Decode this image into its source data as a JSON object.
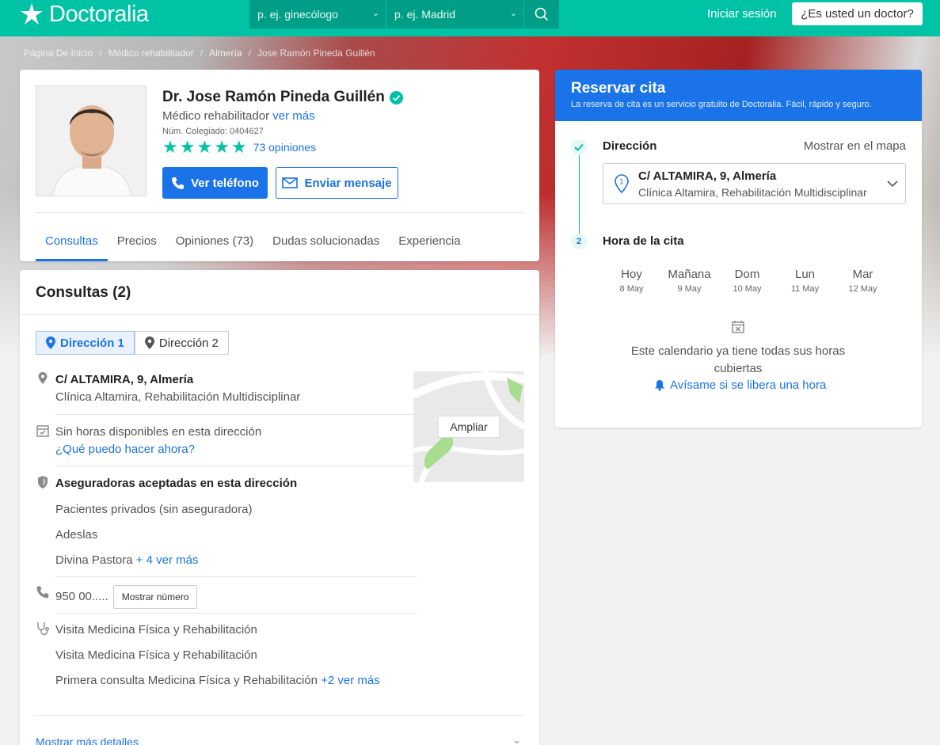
{
  "header": {
    "logo_text": "Doctoralia",
    "search_specialty_placeholder": "p. ej. ginecólogo",
    "search_location_placeholder": "p. ej. Madrid",
    "login_label": "Iniciar sesión",
    "doctor_button_label": "¿Es usted un doctor?",
    "brand_color": "#00c3a5"
  },
  "breadcrumb": [
    "Página De Inicio",
    "Médico rehabilitador",
    "Almería",
    "Jose Ramón Pineda Guillén"
  ],
  "profile": {
    "name": "Dr. Jose Ramón Pineda Guillén",
    "specialty": "Médico rehabilitador",
    "see_more": "ver más",
    "license": "Núm. Colegiado: 0404627",
    "rating_stars": 5,
    "reviews_link": "73 opiniones",
    "phone_button": "Ver teléfono",
    "message_button": "Enviar mensaje",
    "tabs": [
      "Consultas",
      "Precios",
      "Opiniones (73)",
      "Dudas solucionadas",
      "Experiencia"
    ]
  },
  "consultas": {
    "title": "Consultas (2)",
    "address_tabs": [
      "Dirección 1",
      "Dirección 2"
    ],
    "address": "C/ ALTAMIRA, 9, Almería",
    "clinic": "Clínica Altamira, Rehabilitación Multidisciplinar",
    "map_button": "Ampliar",
    "no_slots": "Sin horas disponibles en esta dirección",
    "what_now": "¿Qué puedo hacer ahora?",
    "insurers_title": "Aseguradoras aceptadas en esta dirección",
    "insurers": [
      "Pacientes privados (sin aseguradora)",
      "Adeslas",
      "Divina Pastora"
    ],
    "insurers_more": "+ 4 ver más",
    "phone": "950 00.....",
    "show_number": "Mostrar número",
    "services": [
      "Visita Medicina Física y Rehabilitación",
      "Visita Medicina Física y Rehabilitación",
      "Primera consulta Medicina Física y Rehabilitación"
    ],
    "services_more": "+2 ver más",
    "more_details": "Mostrar más detalles"
  },
  "booking": {
    "title": "Reservar cita",
    "subtitle": "La reserva de cita es un servicio gratuito de Doctoralia. Fácil, rápido y seguro.",
    "step1_label": "Dirección",
    "show_on_map": "Mostrar en el mapa",
    "address_number": "1",
    "address": "C/ ALTAMIRA, 9, Almería",
    "clinic": "Clínica Altamira, Rehabilitación Multidisciplinar",
    "step2_number": "2",
    "step2_label": "Hora de la cita",
    "days": [
      {
        "day": "Hoy",
        "date": "8 May"
      },
      {
        "day": "Mañana",
        "date": "9 May"
      },
      {
        "day": "Dom",
        "date": "10 May"
      },
      {
        "day": "Lun",
        "date": "11 May"
      },
      {
        "day": "Mar",
        "date": "12 May"
      }
    ],
    "full_text": "Este calendario ya tiene todas sus horas cubiertas",
    "notify_link": "Avísame si se libera una hora",
    "accent_color": "#1a73e8"
  }
}
